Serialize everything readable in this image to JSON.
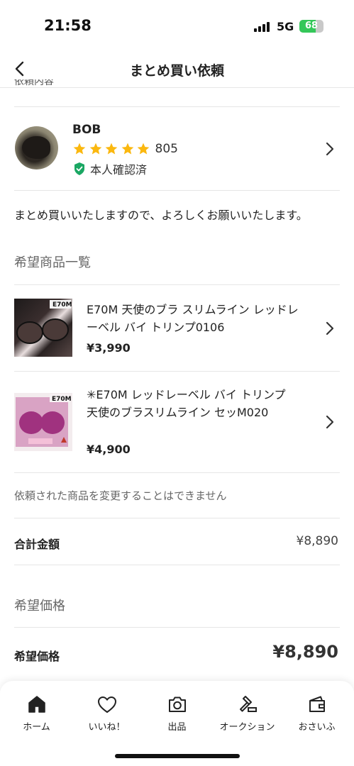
{
  "status_bar": {
    "time": "21:58",
    "network": "5G",
    "battery": "68",
    "battery_level": 0.68
  },
  "nav": {
    "title": "まとめ買い依頼",
    "back_icon": "chevron-left-icon"
  },
  "cut_off_text": "依頼内容",
  "seller": {
    "name": "BOB",
    "rating_stars": 5,
    "rating_count": "805",
    "verified_label": "本人確認済",
    "star_color": "#fbb80f",
    "verified_color": "#1aa763"
  },
  "message": "まとめ買いいたしますので、よろしくお願いいたします。",
  "products_section": {
    "title": "希望商品一覧",
    "items": [
      {
        "name": "E70M 天使のブラ スリムライン レッドレーベル バイ トリンプ0106",
        "price": "¥3,990",
        "thumb_label": "E70M"
      },
      {
        "name": "✳︎E70M レッドレーベル バイ トリンプ 天使のブラスリムライン セッM020",
        "price": "¥4,900",
        "thumb_label": "E70M"
      }
    ],
    "notice": "依頼された商品を変更することはできません"
  },
  "total": {
    "label": "合計金額",
    "value": "¥8,890"
  },
  "desired_section": {
    "title": "希望価格",
    "label": "希望価格",
    "value": "¥8,890"
  },
  "tab_bar": {
    "items": [
      {
        "label": "ホーム",
        "icon": "home-icon"
      },
      {
        "label": "いいね！",
        "icon": "heart-icon"
      },
      {
        "label": "出品",
        "icon": "camera-icon"
      },
      {
        "label": "オークション",
        "icon": "gavel-icon"
      },
      {
        "label": "おさいふ",
        "icon": "wallet-icon"
      }
    ]
  }
}
